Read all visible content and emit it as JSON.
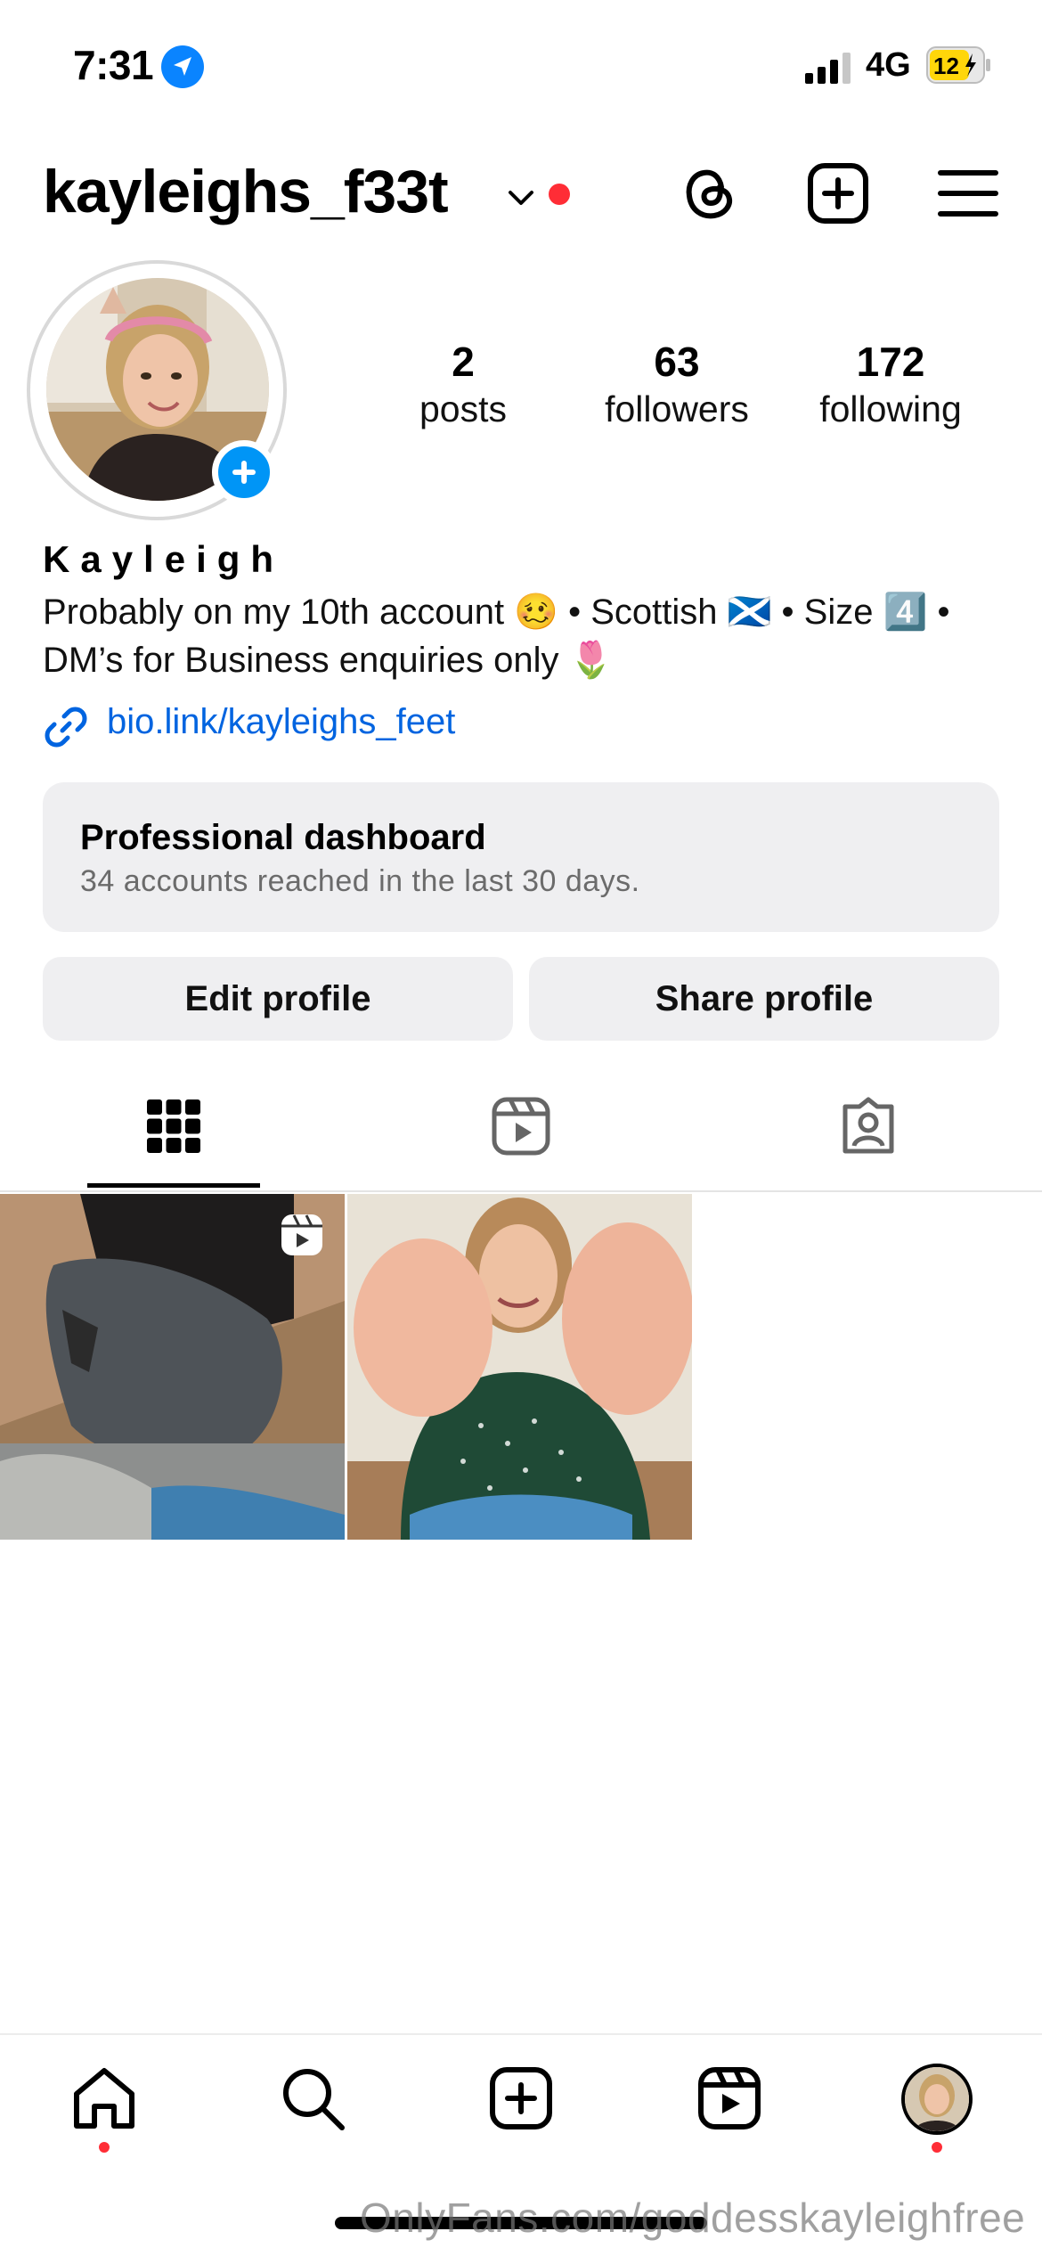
{
  "status_bar": {
    "time": "7:31",
    "network": "4G",
    "battery": "12"
  },
  "header": {
    "username": "kayleighs_f33t"
  },
  "profile": {
    "stats": [
      {
        "value": "2",
        "label": "posts"
      },
      {
        "value": "63",
        "label": "followers"
      },
      {
        "value": "172",
        "label": "following"
      }
    ],
    "display_name": "Kayleigh",
    "bio": "Probably on my 10th account 🥴 • Scottish 🏴󠁧󠁢󠁳󠁣󠁴󠁿 • Size 4️⃣ • DM’s for Business enquiries only 🌷",
    "link": "bio.link/kayleighs_feet"
  },
  "dashboard": {
    "title": "Professional dashboard",
    "subtitle": "34 accounts reached in the last 30 days."
  },
  "actions": {
    "edit_label": "Edit profile",
    "share_label": "Share profile"
  },
  "tabs": [
    "grid-icon",
    "reels-icon",
    "tagged-icon"
  ],
  "active_tab": "grid-icon",
  "bottom_nav": [
    "home-icon",
    "search-icon",
    "create-icon",
    "reels-icon",
    "profile-avatar"
  ],
  "watermark": "OnlyFans.com/goddesskayleighfree",
  "colors": {
    "accent_blue": "#0095f6",
    "link_blue": "#0064e0",
    "notification_red": "#ff2d36",
    "card_gray": "#efeff1"
  }
}
